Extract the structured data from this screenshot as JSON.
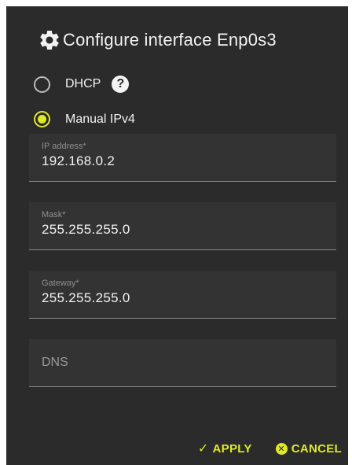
{
  "dialog": {
    "title": "Configure interface Enp0s3",
    "title_icon": "gear-icon"
  },
  "options": {
    "dhcp": {
      "label": "DHCP",
      "selected": false,
      "help_icon": "help-icon"
    },
    "manual": {
      "label": "Manual IPv4",
      "selected": true
    }
  },
  "fields": {
    "ip_address": {
      "label": "IP address*",
      "value": "192.168.0.2"
    },
    "mask": {
      "label": "Mask*",
      "value": "255.255.255.0"
    },
    "gateway": {
      "label": "Gateway*",
      "value": "255.255.255.0"
    },
    "dns": {
      "placeholder": "DNS",
      "value": ""
    }
  },
  "actions": {
    "apply_label": "APPLY",
    "cancel_label": "CANCEL"
  },
  "colors": {
    "accent": "#e0ea1e",
    "background": "#2b2b2b",
    "field_background": "#333333"
  }
}
